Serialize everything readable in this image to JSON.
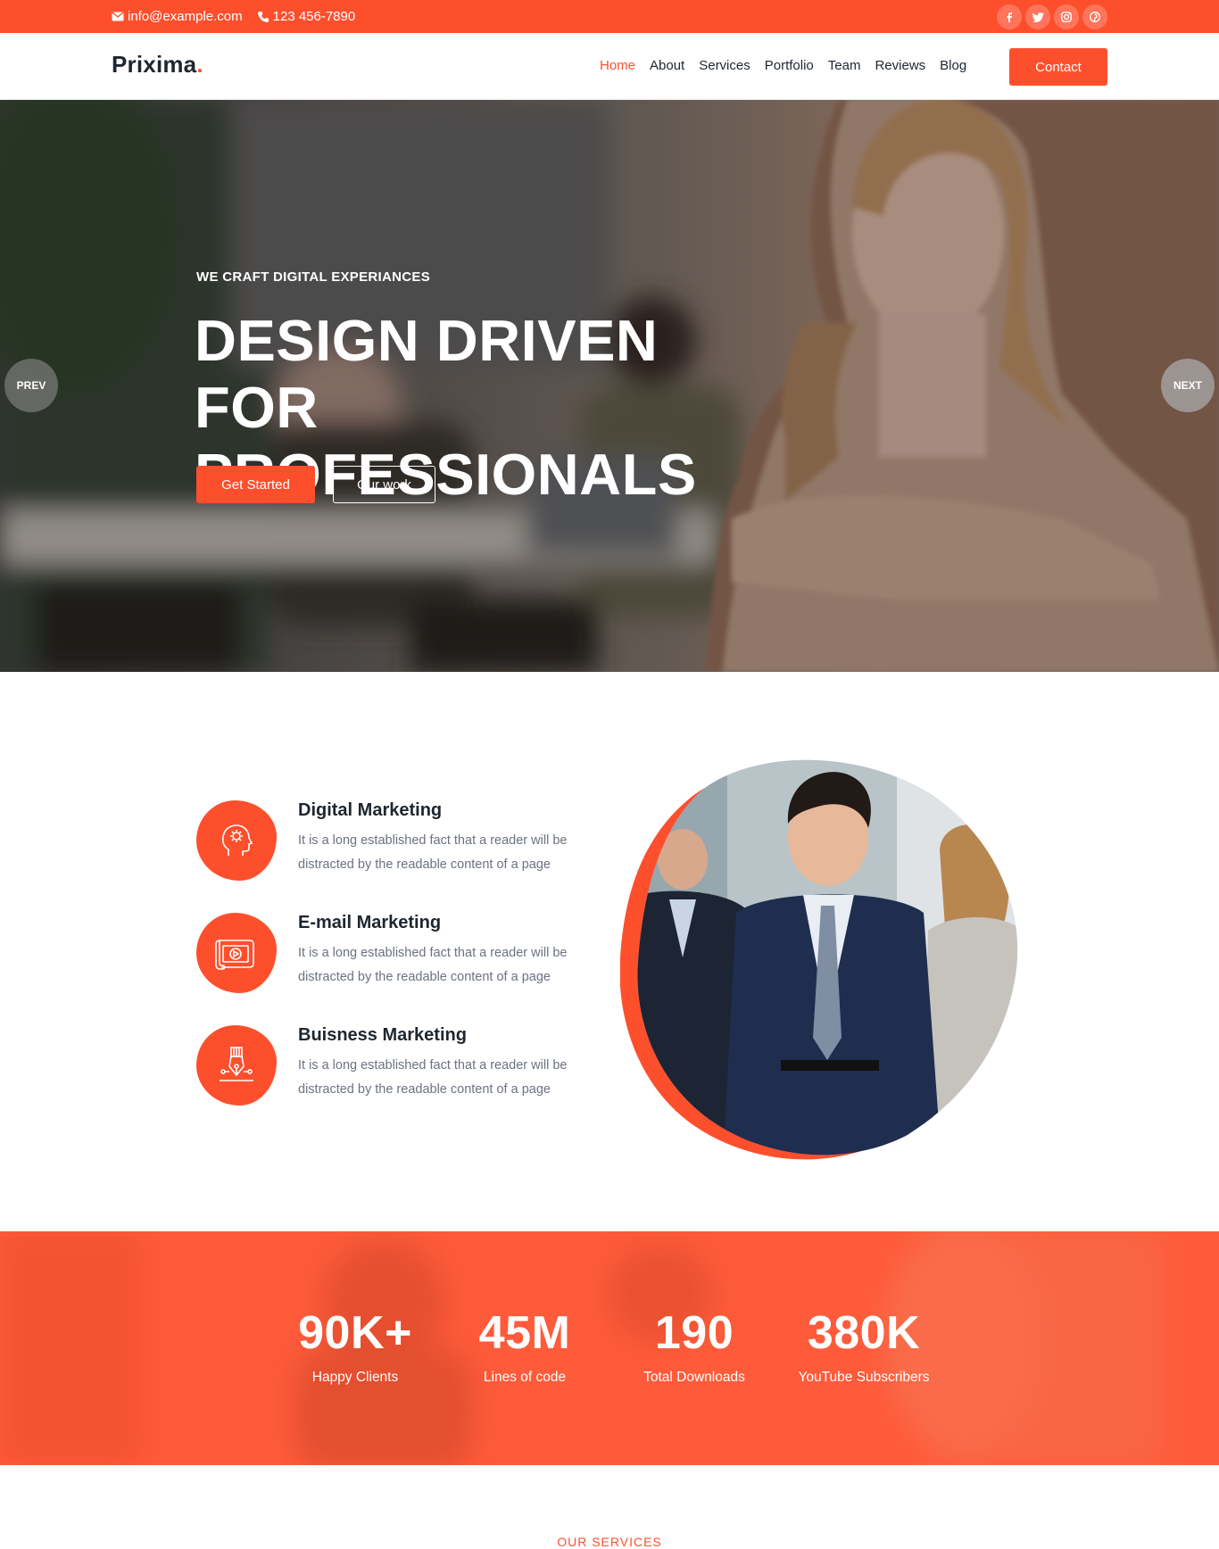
{
  "topbar": {
    "email": "info@example.com",
    "phone": "123 456-7890",
    "social": [
      "facebook-icon",
      "twitter-icon",
      "instagram-icon",
      "pinterest-icon"
    ]
  },
  "header": {
    "logo": "Prixima",
    "logo_dot": ".",
    "nav": [
      "Home",
      "About",
      "Services",
      "Portfolio",
      "Team",
      "Reviews",
      "Blog"
    ],
    "active_nav": "Home",
    "contact_label": "Contact"
  },
  "hero": {
    "eyebrow": "WE CRAFT DIGITAL EXPERIANCES",
    "title_line1": "DESIGN DRIVEN FOR",
    "title_line2": "PROFESSIONALS",
    "primary_label": "Get Started",
    "secondary_label": "Our work",
    "prev_label": "PREV",
    "next_label": "NEXT"
  },
  "features": [
    {
      "title": "Digital Marketing",
      "text": "It is a long established fact that a reader will be distracted by the readable content of a page",
      "icon": "brain-gear-icon"
    },
    {
      "title": "E-mail Marketing",
      "text": "It is a long established fact that a reader will be distracted by the readable content of a page",
      "icon": "video-scroll-icon"
    },
    {
      "title": "Buisness Marketing",
      "text": "It is a long established fact that a reader will be distracted by the readable content of a page",
      "icon": "pen-nib-icon"
    }
  ],
  "stats": [
    {
      "value": "90K+",
      "label": "Happy Clients"
    },
    {
      "value": "45M",
      "label": "Lines of code"
    },
    {
      "value": "190",
      "label": "Total Downloads"
    },
    {
      "value": "380K",
      "label": "YouTube Subscribers"
    }
  ],
  "section_heading": "OUR SERVICES",
  "colors": {
    "accent": "#fe4f2d",
    "dark": "#1e2630",
    "muted": "#6b7280"
  }
}
